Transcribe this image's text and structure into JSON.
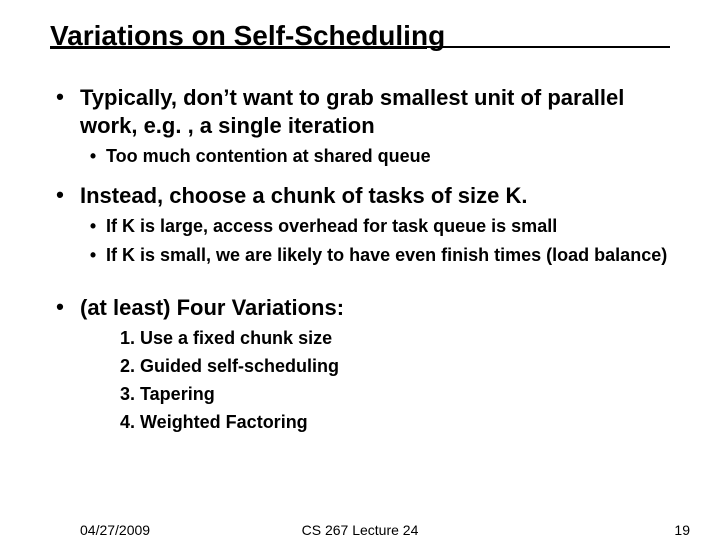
{
  "title": "Variations on Self-Scheduling",
  "bullets": {
    "b1": {
      "text": "Typically, don’t want to grab smallest unit of parallel work, e.g. , a single iteration",
      "sub": [
        "Too much contention at shared queue"
      ]
    },
    "b2": {
      "text": "Instead, choose a chunk of tasks of size K.",
      "sub": [
        "If K is large, access overhead for task queue is small",
        "If K is small, we are likely to have even finish times (load balance)"
      ]
    },
    "b3": {
      "text": "(at least) Four Variations:",
      "numbered": [
        "1. Use a fixed chunk size",
        "2. Guided self-scheduling",
        "3. Tapering",
        "4. Weighted Factoring"
      ]
    }
  },
  "footer": {
    "date": "04/27/2009",
    "center": "CS 267 Lecture 24",
    "page": "19"
  }
}
